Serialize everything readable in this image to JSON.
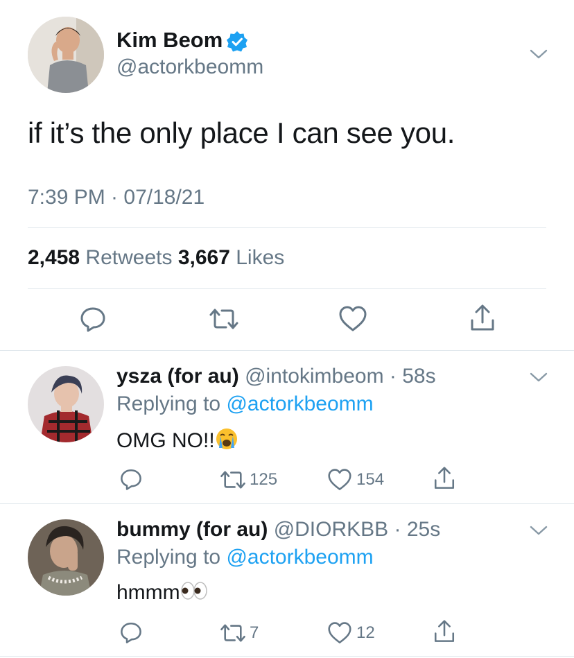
{
  "main_tweet": {
    "display_name": "Kim Beom",
    "verified": true,
    "handle": "@actorkbeomm",
    "text": "if it’s the only place I can see you.",
    "timestamp": "7:39 PM · 07/18/21",
    "retweets_count": "2,458",
    "retweets_label": "Retweets",
    "likes_count": "3,667",
    "likes_label": "Likes",
    "actions": [
      "reply-icon",
      "retweet-icon",
      "like-icon",
      "share-icon"
    ]
  },
  "replies": [
    {
      "display_name": "ysza (for au)",
      "meta": "@intokimbeom · 58s",
      "replying_prefix": "Replying to",
      "replying_to": "@actorkbeomm",
      "text": "OMG NO!!",
      "emoji": "loudly-crying-face",
      "retweet_count": "125",
      "like_count": "154"
    },
    {
      "display_name": "bummy (for au)",
      "meta": "@DIORKBB · 25s",
      "replying_prefix": "Replying to",
      "replying_to": "@actorkbeomm",
      "text": "hmmm",
      "emoji": "eyes",
      "retweet_count": "7",
      "like_count": "12"
    }
  ],
  "colors": {
    "text_primary": "#14171a",
    "text_secondary": "#657786",
    "link": "#1da1f2",
    "divider": "#e1e8ed",
    "verified_badge": "#1da1f2"
  }
}
